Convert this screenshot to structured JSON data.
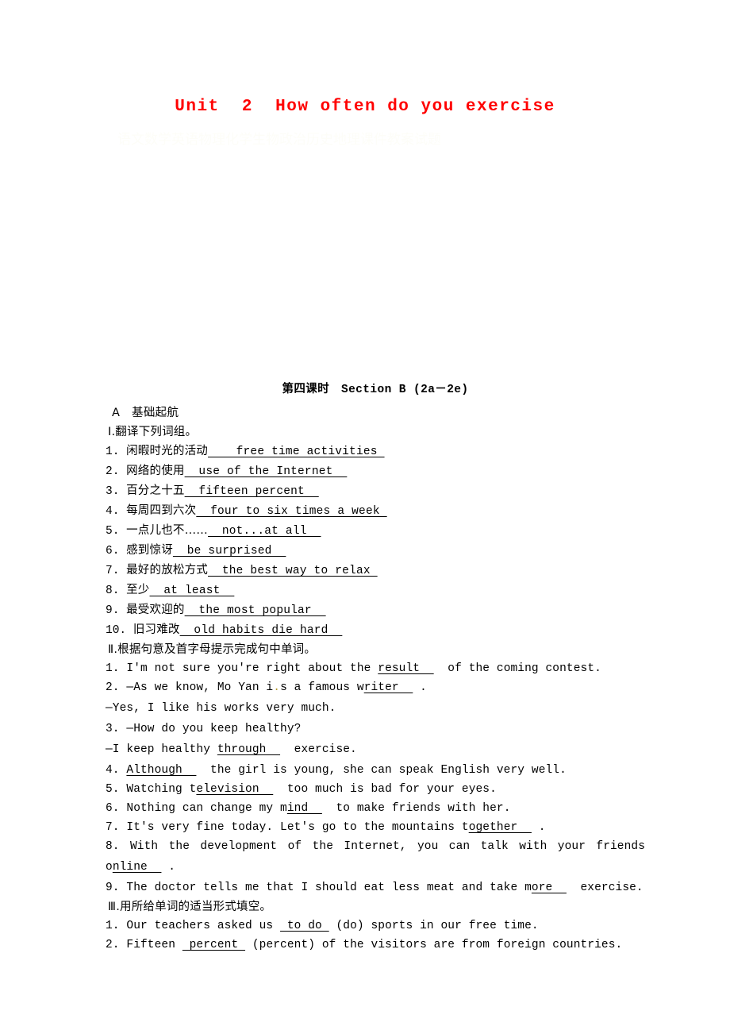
{
  "title": "Unit  2  How often do you exercise",
  "title_color": "#ff0000",
  "watermark": "语文数学英语物理化学生物政治历史地理课件教案试题",
  "section": {
    "lesson": "第四课时",
    "name": "Section B (2a－2e)"
  },
  "part_a": {
    "letter": "A",
    "label": "基础起航"
  },
  "roman_1": {
    "numeral": "Ⅰ.",
    "instruction": "翻译下列词组。"
  },
  "translations": [
    {
      "num": "1.",
      "cn": "闲暇时光的活动",
      "answer": "free time activities",
      "pre": 4,
      "post": 1
    },
    {
      "num": "2.",
      "cn": "网络的使用",
      "answer": "use of the Internet",
      "pre": 2,
      "post": 2
    },
    {
      "num": "3.",
      "cn": "百分之十五",
      "answer": "fifteen percent",
      "pre": 2,
      "post": 2
    },
    {
      "num": "4.",
      "cn": "每周四到六次",
      "answer": "four to six times a week",
      "pre": 2,
      "post": 1
    },
    {
      "num": "5.",
      "cn": "一点儿也不……",
      "answer": "not...at all",
      "pre": 2,
      "post": 2
    },
    {
      "num": "6.",
      "cn": "感到惊讶",
      "answer": "be surprised",
      "pre": 2,
      "post": 2
    },
    {
      "num": "7.",
      "cn": "最好的放松方式",
      "answer": "the best way to relax",
      "pre": 2,
      "post": 1
    },
    {
      "num": "8.",
      "cn": "至少",
      "answer": "at least",
      "pre": 2,
      "post": 2
    },
    {
      "num": "9.",
      "cn": "最受欢迎的",
      "answer": "the most popular",
      "pre": 2,
      "post": 2
    },
    {
      "num": "10.",
      "cn": "旧习难改",
      "answer": "old habits die hard",
      "pre": 2,
      "post": 2
    }
  ],
  "roman_2": {
    "numeral": "Ⅱ.",
    "instruction": "根据句意及首字母提示完成句中单词。"
  },
  "fill_letter": [
    {
      "num": "1.",
      "before": "I'm not sure you're right about the ",
      "answer": "result",
      "after": "  of the coming contest.",
      "style": "plain"
    },
    {
      "num": "2.",
      "before": "—As we know, Mo Yan i",
      "mark": ".",
      "mid": "s a famous w",
      "answer": "riter",
      "after": " .",
      "style": "marked"
    },
    {
      "num": "",
      "before": "—Yes, I like his works very much.",
      "answer": "",
      "after": "",
      "style": "cont"
    },
    {
      "num": "3.",
      "before": "—How do you keep healthy?",
      "answer": "",
      "after": "",
      "style": "plain"
    },
    {
      "num": "",
      "before": "—I keep healthy ",
      "answer": "through",
      "after": "  exercise.",
      "style": "cont"
    },
    {
      "num": "4.",
      "before": "",
      "answer": "Although",
      "after": "  the girl is young, she can speak English very well.",
      "style": "plain"
    },
    {
      "num": "5.",
      "before": "Watching t",
      "answer": "elevision",
      "after": "  too much is bad for your eyes.",
      "style": "plain"
    },
    {
      "num": "6.",
      "before": "Nothing can change my m",
      "answer": "ind",
      "after": "  to make friends with her.",
      "style": "plain"
    },
    {
      "num": "7.",
      "before": "It's very fine today. Let's go to the mountains t",
      "answer": "ogether",
      "after": " .",
      "style": "plain"
    },
    {
      "num": "8.",
      "before": "With the development of the Internet, you can talk with your friends",
      "answer": "",
      "after": "",
      "style": "justify"
    },
    {
      "num": "",
      "before": "o",
      "answer": "nline",
      "after": " .",
      "style": "cont"
    },
    {
      "num": "9.",
      "before": "The doctor tells me that I should eat less meat and take m",
      "answer": "ore",
      "after": "  exercise.",
      "style": "plain"
    }
  ],
  "roman_3": {
    "numeral": "Ⅲ.",
    "instruction": "用所给单词的适当形式填空。"
  },
  "word_form": [
    {
      "num": "1.",
      "before": "Our teachers asked us ",
      "answer": " to do ",
      "after": " (do) sports in our free time."
    },
    {
      "num": "2.",
      "before": "Fifteen ",
      "answer": " percent ",
      "after": " (percent) of the visitors are from foreign countries."
    }
  ]
}
